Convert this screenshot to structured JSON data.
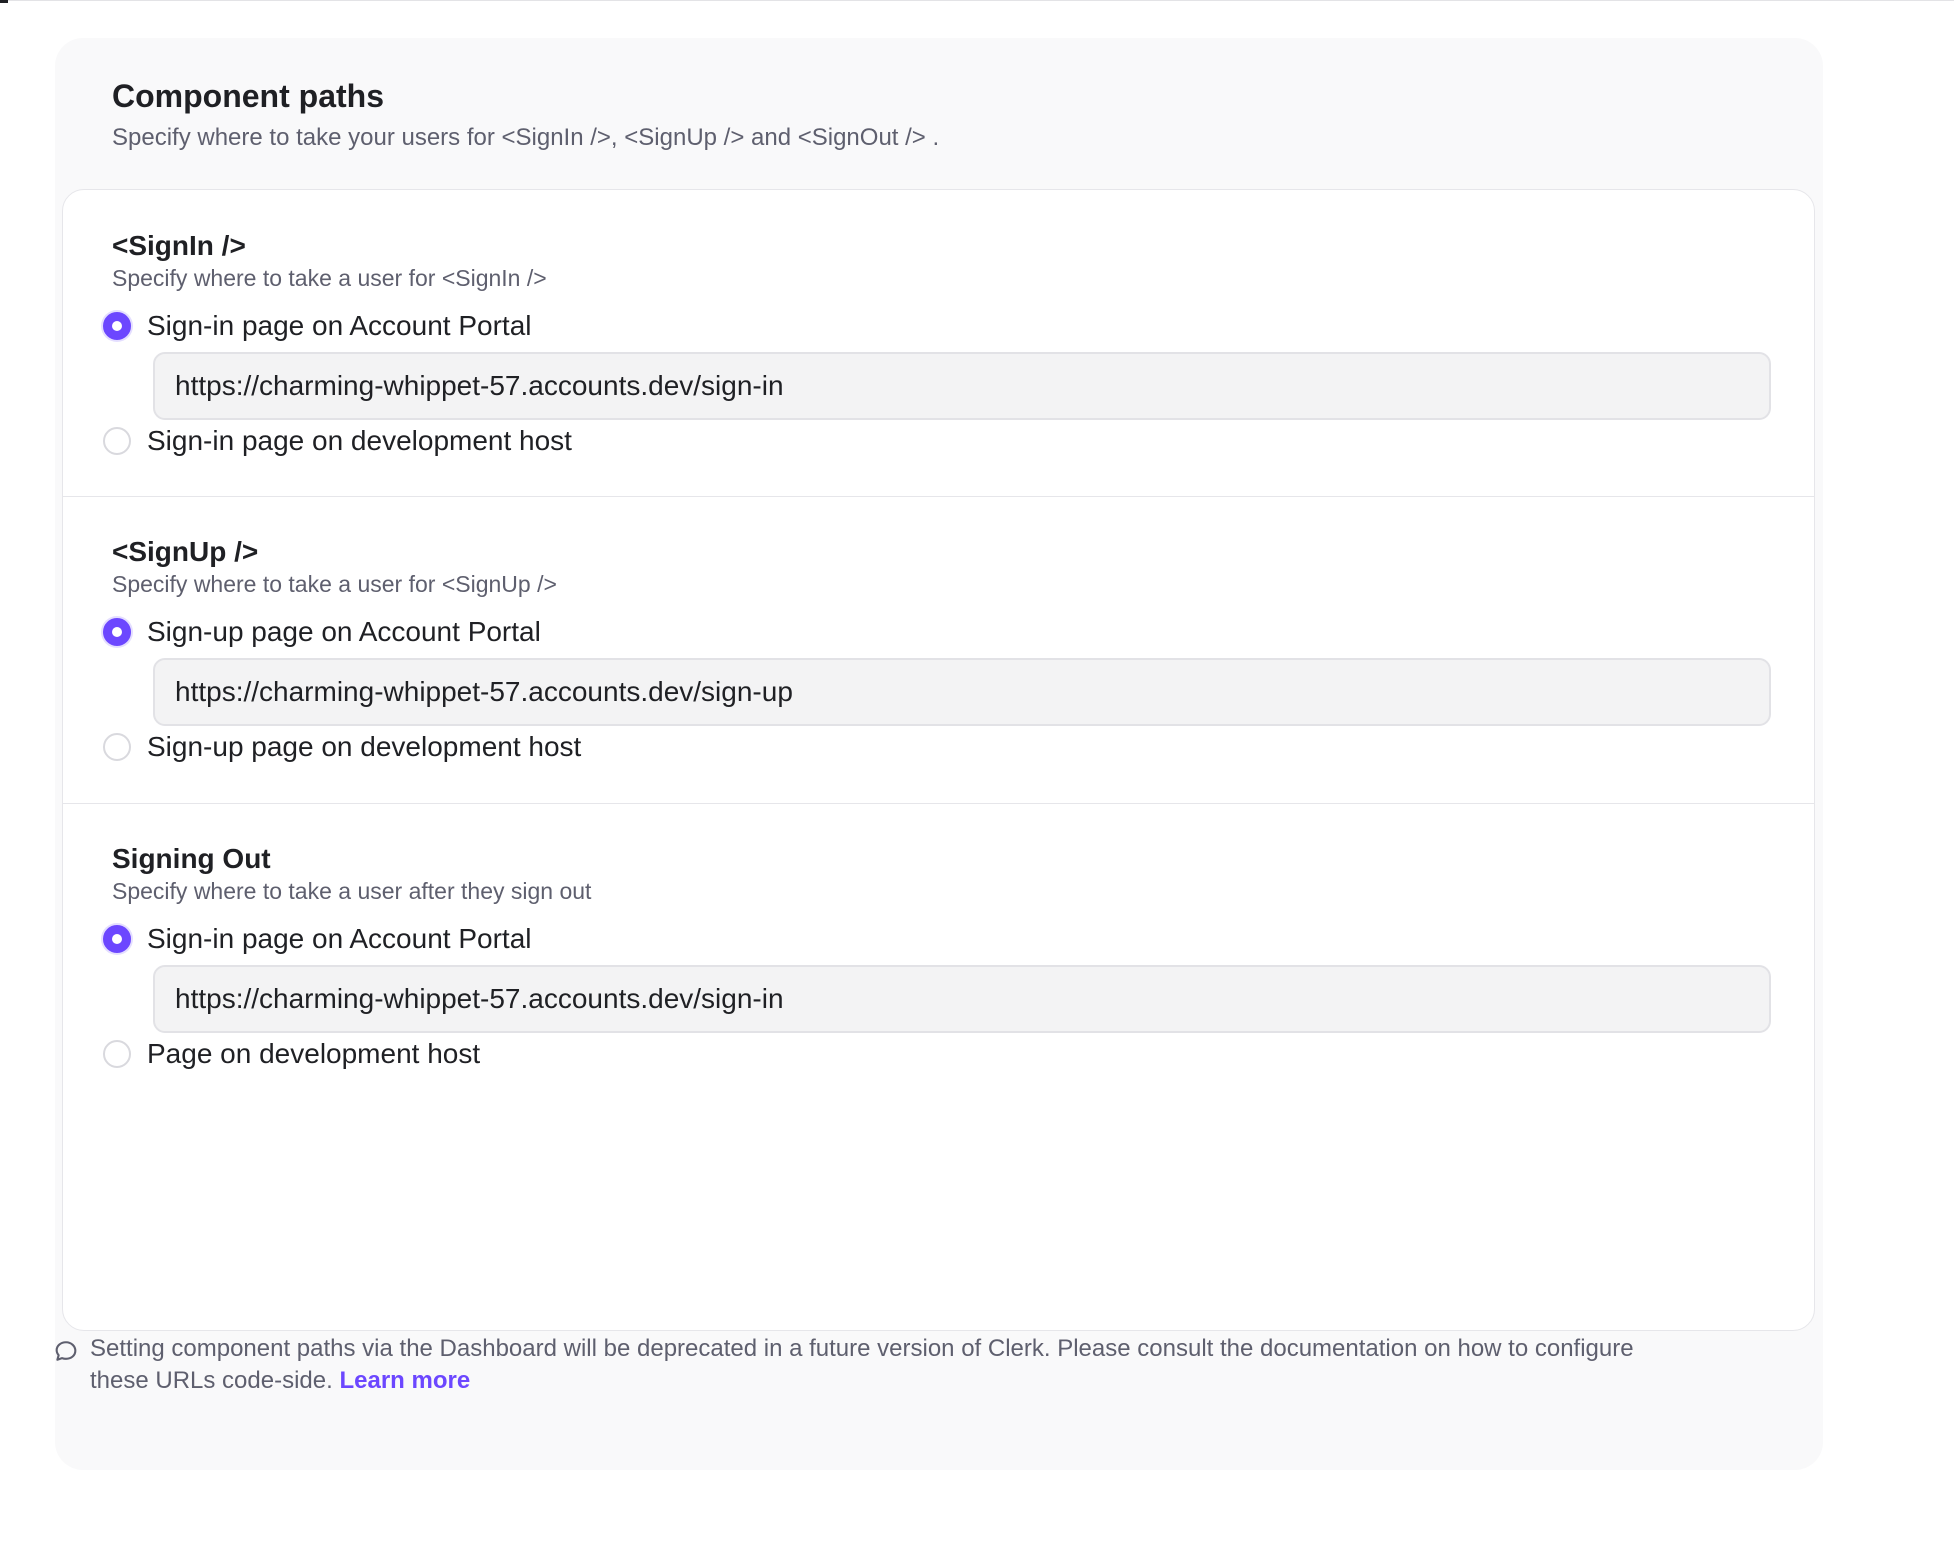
{
  "card": {
    "title": "Component paths",
    "subtitle": "Specify where to take your users for <SignIn />, <SignUp /> and <SignOut /> ."
  },
  "sections": [
    {
      "title": "<SignIn />",
      "description": "Specify where to take a user for <SignIn />",
      "option_primary": "Sign-in page on Account Portal",
      "url": "https://charming-whippet-57.accounts.dev/sign-in",
      "option_secondary": "Sign-in page on development host",
      "selected": "primary"
    },
    {
      "title": "<SignUp />",
      "description": "Specify where to take a user for <SignUp />",
      "option_primary": "Sign-up page on Account Portal",
      "url": "https://charming-whippet-57.accounts.dev/sign-up",
      "option_secondary": "Sign-up page on development host",
      "selected": "primary"
    },
    {
      "title": "Signing Out",
      "description": "Specify where to take a user after they sign out",
      "option_primary": "Sign-in page on Account Portal",
      "url": "https://charming-whippet-57.accounts.dev/sign-in",
      "option_secondary": "Page on development host",
      "selected": "primary"
    }
  ],
  "footer": {
    "icon": "speech-bubble-icon",
    "text": "Setting component paths via the Dashboard will be deprecated in a future version of Clerk. Please consult the documentation on how to configure these URLs code-side.",
    "link_label": "Learn more"
  },
  "colors": {
    "accent": "#6c47ff",
    "muted_text": "#5e5f6e",
    "card_bg": "#f9f9fa"
  }
}
